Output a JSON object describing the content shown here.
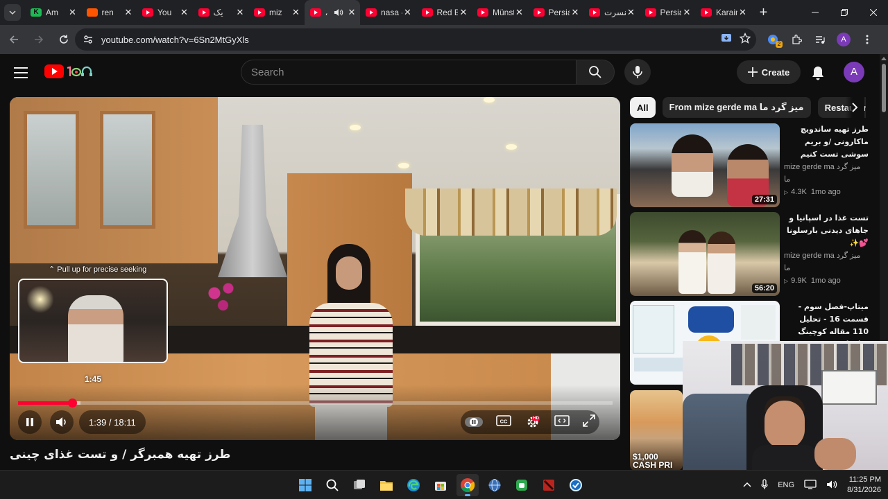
{
  "browser": {
    "tabs": [
      {
        "title": "Am",
        "favicon": "kick-icon",
        "active": false
      },
      {
        "title": "ren",
        "favicon": "soundcloud-icon",
        "active": false
      },
      {
        "title": "You",
        "favicon": "youtube-icon",
        "active": false
      },
      {
        "title": "یک",
        "favicon": "youtube-icon",
        "active": false
      },
      {
        "title": "miz",
        "favicon": "youtube-icon",
        "active": false
      },
      {
        "title": "،",
        "favicon": "youtube-icon",
        "active": true
      },
      {
        "title": "nasa - Y",
        "favicon": "youtube-icon",
        "active": false
      },
      {
        "title": "Red Bul",
        "favicon": "youtube-icon",
        "active": false
      },
      {
        "title": "Münste",
        "favicon": "youtube-icon",
        "active": false
      },
      {
        "title": "Persian",
        "favicon": "youtube-icon",
        "active": false
      },
      {
        "title": "کنسرت",
        "favicon": "youtube-icon",
        "active": false
      },
      {
        "title": "Persian",
        "favicon": "youtube-icon",
        "active": false
      },
      {
        "title": "Karaind",
        "favicon": "youtube-icon",
        "active": false
      }
    ],
    "url": "youtube.com/watch?v=6Sn2MtGyXls",
    "profile_initial": "A",
    "extension_badge": "2"
  },
  "youtube": {
    "search_placeholder": "Search",
    "create_label": "Create",
    "avatar_initial": "A",
    "player": {
      "seek_hint": "⌃ Pull up for precise seeking",
      "preview_time": "1:45",
      "time_display": "1:39 / 18:11",
      "progress_fraction": 0.091,
      "buffered_fraction": 0.105,
      "hd_badge": "HD"
    },
    "video_title": "طرز تهیه همبرگر / و تست غذای چینی",
    "chips": [
      "All",
      "From mize gerde ma میز گرد ما",
      "Restaurants"
    ],
    "recommendations": [
      {
        "title": "طرز تهیه ساندویچ ماکارونی /و بریم سوشی تست کنیم",
        "channel": "mize gerde ma میز گرد ما",
        "views": "4.3K",
        "age": "1mo ago",
        "duration": "27:31"
      },
      {
        "title": "تست غذا در اسپانیا و جاهای دیدنی بارسلونا 💕✨",
        "channel": "mize gerde ma میز گرد ما",
        "views": "9.9K",
        "age": "1mo ago",
        "duration": "56:20"
      },
      {
        "title": "میتاپ-فصل سوم - قسمت 16 - تحلیل 110 مقاله کوچینگ سازمانی - زهره زین الدینی",
        "channel": "",
        "views": "",
        "age": "",
        "duration": ""
      },
      {
        "title": "",
        "channel": "",
        "views": "",
        "age": "",
        "duration": "",
        "thumb_text": "$1,000 CASH PRI"
      }
    ]
  },
  "taskbar": {
    "language": "ENG",
    "time": "11:25 PM",
    "date": "8/31/2026"
  },
  "colors": {
    "youtube_red": "#ff0033",
    "page_bg": "#0f0f0f",
    "chip_bg": "#272727"
  }
}
